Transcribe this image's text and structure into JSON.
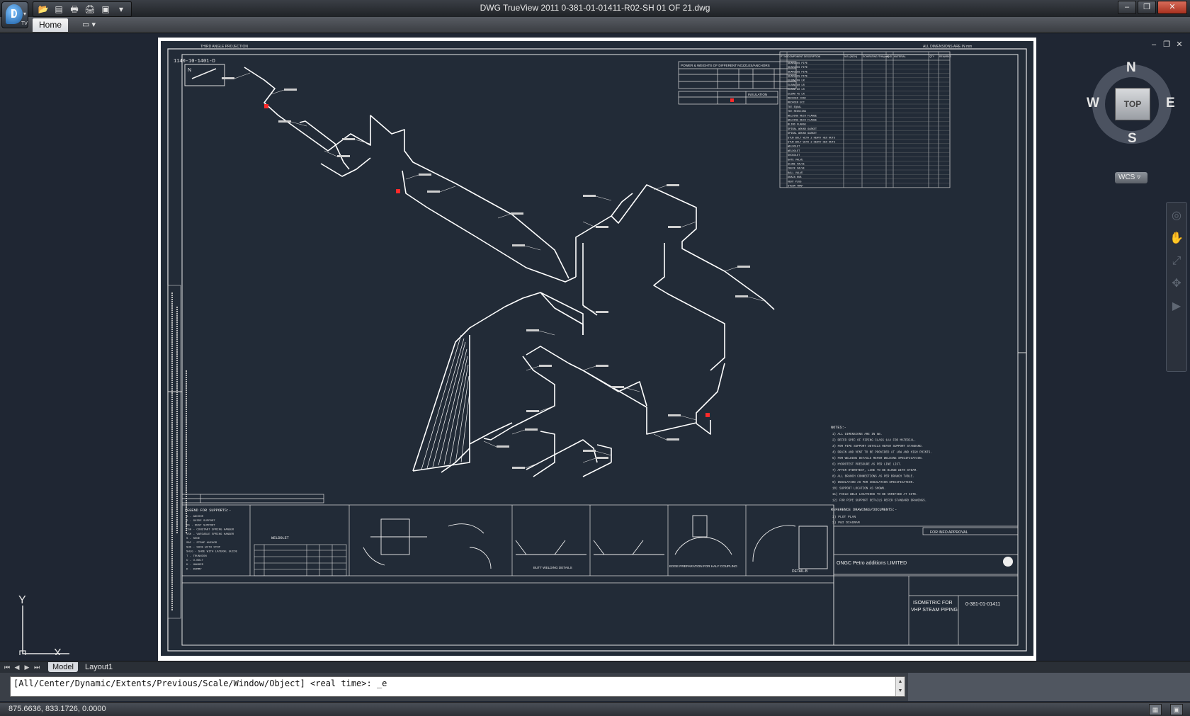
{
  "window": {
    "title": "DWG TrueView 2011    0-381-01-01411-R02-SH 01 OF 21.dwg",
    "app_badge": "TV",
    "controls": {
      "minimize": "–",
      "restore": "❐",
      "close": "✕"
    }
  },
  "quick_access": {
    "icons": [
      "open-icon",
      "dwg-convert-icon",
      "plot-icon",
      "batch-plot-icon",
      "preview-icon"
    ],
    "glyphs": [
      "📂",
      "▤",
      "🖶",
      "🖨",
      "▣"
    ]
  },
  "ribbon": {
    "tabs": [
      "Home"
    ],
    "minimize_glyph": "▭ ▾"
  },
  "canvas_controls": {
    "minimize": "–",
    "restore": "❐",
    "close": "✕"
  },
  "viewcube": {
    "face": "TOP",
    "north": "N",
    "south": "S",
    "east": "E",
    "west": "W",
    "wcs": "WCS ▿"
  },
  "ucs": {
    "y": "Y",
    "x": "X"
  },
  "drawing": {
    "projection_note": "THIRD ANGLE PROJECTION",
    "all_dims": "ALL DIMENSIONS ARE IN mm",
    "line_number": "1140-10-1401-D",
    "north": "N",
    "bom_title": "POWER & WEIGHTS OF DIFFERENT NOZZLES/ANCHORS",
    "insulation_title": "INSULATION",
    "bom_columns": [
      "PT NO",
      "COMPONENT DESCRIPTION",
      "N.B. (INCH)",
      "SCH/RATING /THK(mm)",
      "END",
      "MATERIAL",
      "QTY",
      "REMARKS"
    ],
    "bom_rows": [
      "SEAMLESS PIPE",
      "SEAMLESS PIPE",
      "SEAMLESS PIPE",
      "SEAMLESS PIPE",
      "ELBOW 90 LR",
      "ELBOW 90 LR",
      "ELBOW 90 LR",
      "ELBOW 45 LR",
      "REDUCER CONC",
      "REDUCER ECC",
      "TEE EQUAL",
      "TEE REDUCING",
      "WELDING NECK FLANGE",
      "WELDING NECK FLANGE",
      "BLIND FLANGE",
      "SPIRAL WOUND GASKET",
      "SPIRAL WOUND GASKET",
      "STUD BOLT WITH 2 HEAVY HEX NUTS",
      "STUD BOLT WITH 2 HEAVY HEX NUTS",
      "WELDOLET",
      "WELDOLET",
      "SOCKOLET",
      "GATE VALVE",
      "GLOBE VALVE",
      "CHECK VALVE",
      "BALL VALVE",
      "DRAIN HUB",
      "VENT PLUG",
      "STEAM TRAP"
    ],
    "notes_title": "NOTES:-",
    "notes": [
      "1) ALL DIMENSIONS ARE IN mm.",
      "2) REFER SPEC OF PIPING CLASS 1A4 FOR MATERIAL.",
      "3) FOR PIPE SUPPORT DETAILS REFER SUPPORT STANDARD.",
      "4) DRAIN AND VENT TO BE PROVIDED AT LOW AND HIGH POINTS.",
      "5) FOR WELDING DETAILS REFER WELDING SPECIFICATION.",
      "6) HYDROTEST PRESSURE AS PER LINE LIST.",
      "7) AFTER HYDROTEST, LINE TO BE BLOWN WITH STEAM.",
      "8) ALL BRANCH CONNECTIONS AS PER BRANCH TABLE.",
      "9) INSULATION AS PER INSULATION SPECIFICATION.",
      "10) SUPPORT LOCATION AS SHOWN.",
      "11) FIELD WELD LOCATIONS TO BE VERIFIED AT SITE.",
      "12) FOR PIPE SUPPORT DETAILS REFER STANDARD DRAWINGS."
    ],
    "ref_title": "REFERENCE DRAWINGS/DOCUMENTS:-",
    "refs": [
      "1) PLOT PLAN",
      "2) P&I DIAGRAM"
    ],
    "approval": "FOR INFO APPROVAL",
    "company": "ONGC Petro additions LIMITED",
    "legend_title": "LEGEND FOR SUPPORTS:-",
    "legend": [
      "A  - ANCHOR",
      "G  - GUIDE SUPPORT",
      "RS - REST SUPPORT",
      "CSH - CONSTANT SPRING HANGER",
      "VSH - VARIABLE SPRING HANGER",
      "S  - SHOE",
      "SAC - STRAP ANCHOR",
      "SHS - SHOE WITH STOP",
      "SHLG - SHOE WITH LATERAL GUIDE",
      "T  - TRUNNION",
      "U  - U-BOLT",
      "H  - HANGER",
      "D  - DUMMY"
    ],
    "weldolet_title": "WELDOLET",
    "welding_detail": "BUTT WELDING DETAILS",
    "weld_prep": "EDGE PREPARATION FOR HALF COUPLING",
    "detail_b": "DETAIL-B",
    "title_main": "ISOMETRIC FOR",
    "title_sub": "VHP STEAM PIPING",
    "drawing_no": "0-381-01-01411",
    "sheet": "SH 01 OF 21",
    "revision": "R02"
  },
  "layout_tabs": [
    "Model",
    "Layout1"
  ],
  "command_line": {
    "text": "[All/Center/Dynamic/Extents/Previous/Scale/Window/Object] <real time>: _e"
  },
  "status_bar": {
    "coordinates": "875.6636,  833.1726, 0.0000"
  },
  "colors": {
    "canvas_bg": "#1f2633",
    "sheet_bg": "#222b37",
    "sheet_paper": "#ffffff",
    "pipe_line": "#ffffff",
    "highlight_red": "#ff2a2a"
  }
}
